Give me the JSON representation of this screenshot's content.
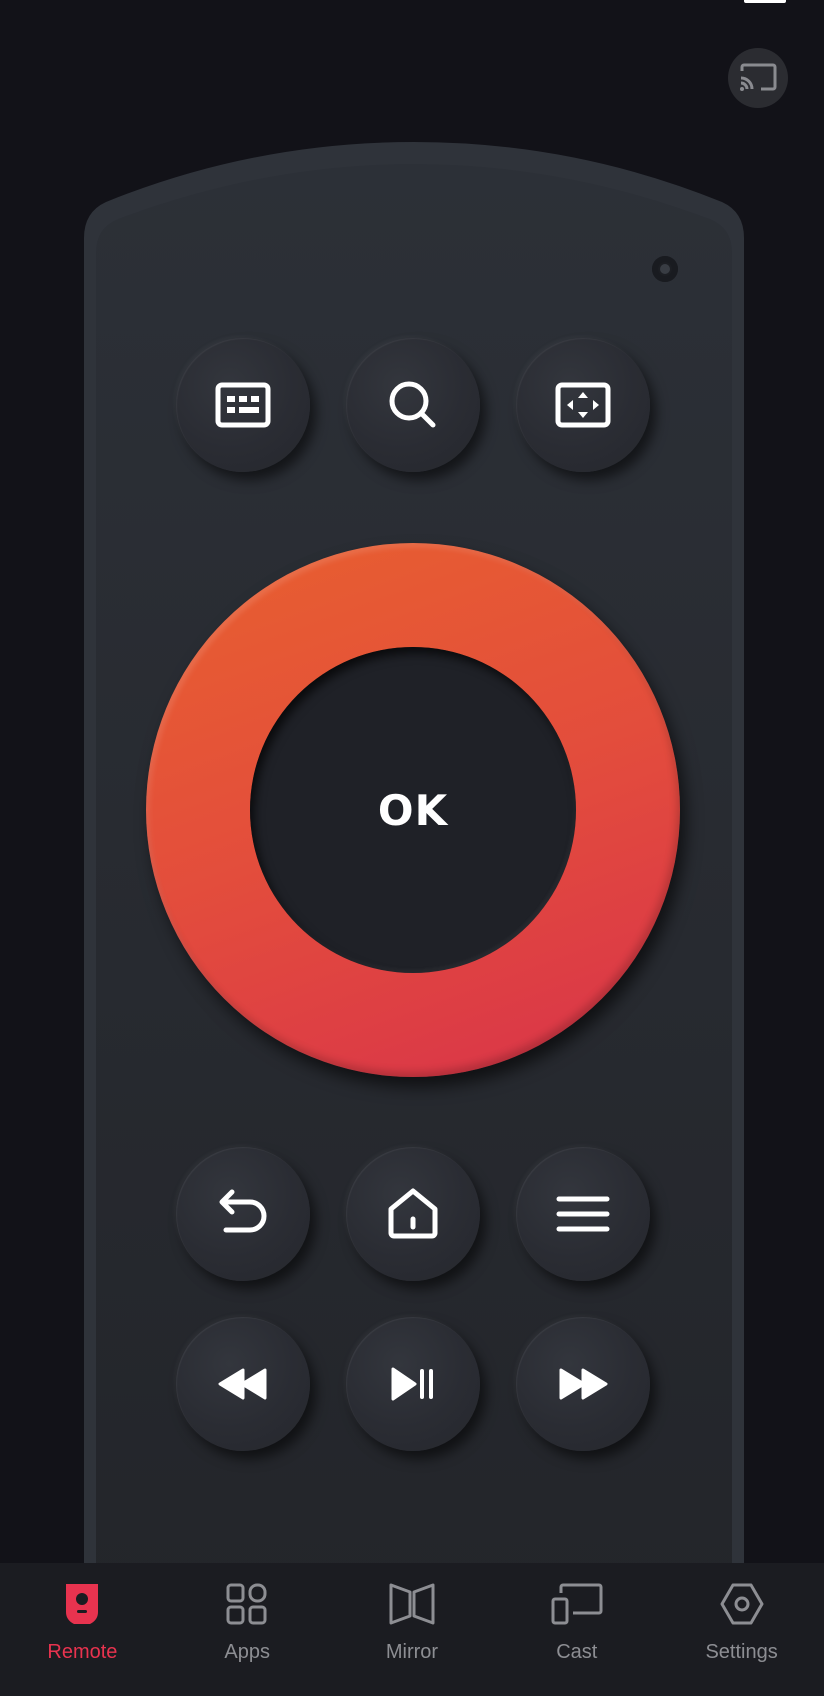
{
  "colors": {
    "background": "#121218",
    "remote_body": "#2a2d33",
    "button": "#2a2c33",
    "dpad_gradient_start": "#e8602f",
    "dpad_gradient_end": "#d9334a",
    "accent": "#e8334f",
    "tab_inactive": "#8d8e93",
    "icon": "#ffffff"
  },
  "header": {
    "cast_button_icon": "cast-icon"
  },
  "remote": {
    "top_row": [
      {
        "name": "keyboard",
        "icon": "keyboard-icon"
      },
      {
        "name": "search",
        "icon": "search-icon"
      },
      {
        "name": "aspect",
        "icon": "aspect-ratio-icon"
      }
    ],
    "dpad": {
      "ok_label": "OK"
    },
    "nav_row": [
      {
        "name": "back",
        "icon": "back-icon"
      },
      {
        "name": "home",
        "icon": "home-icon"
      },
      {
        "name": "menu",
        "icon": "menu-icon"
      }
    ],
    "media_row": [
      {
        "name": "rewind",
        "icon": "rewind-icon"
      },
      {
        "name": "play-pause",
        "icon": "play-pause-icon"
      },
      {
        "name": "fast-forward",
        "icon": "fast-forward-icon"
      }
    ]
  },
  "tabbar": {
    "active": "Remote",
    "items": [
      {
        "label": "Remote",
        "icon": "remote-icon"
      },
      {
        "label": "Apps",
        "icon": "apps-icon"
      },
      {
        "label": "Mirror",
        "icon": "mirror-icon"
      },
      {
        "label": "Cast",
        "icon": "cast-icon"
      },
      {
        "label": "Settings",
        "icon": "settings-icon"
      }
    ]
  }
}
